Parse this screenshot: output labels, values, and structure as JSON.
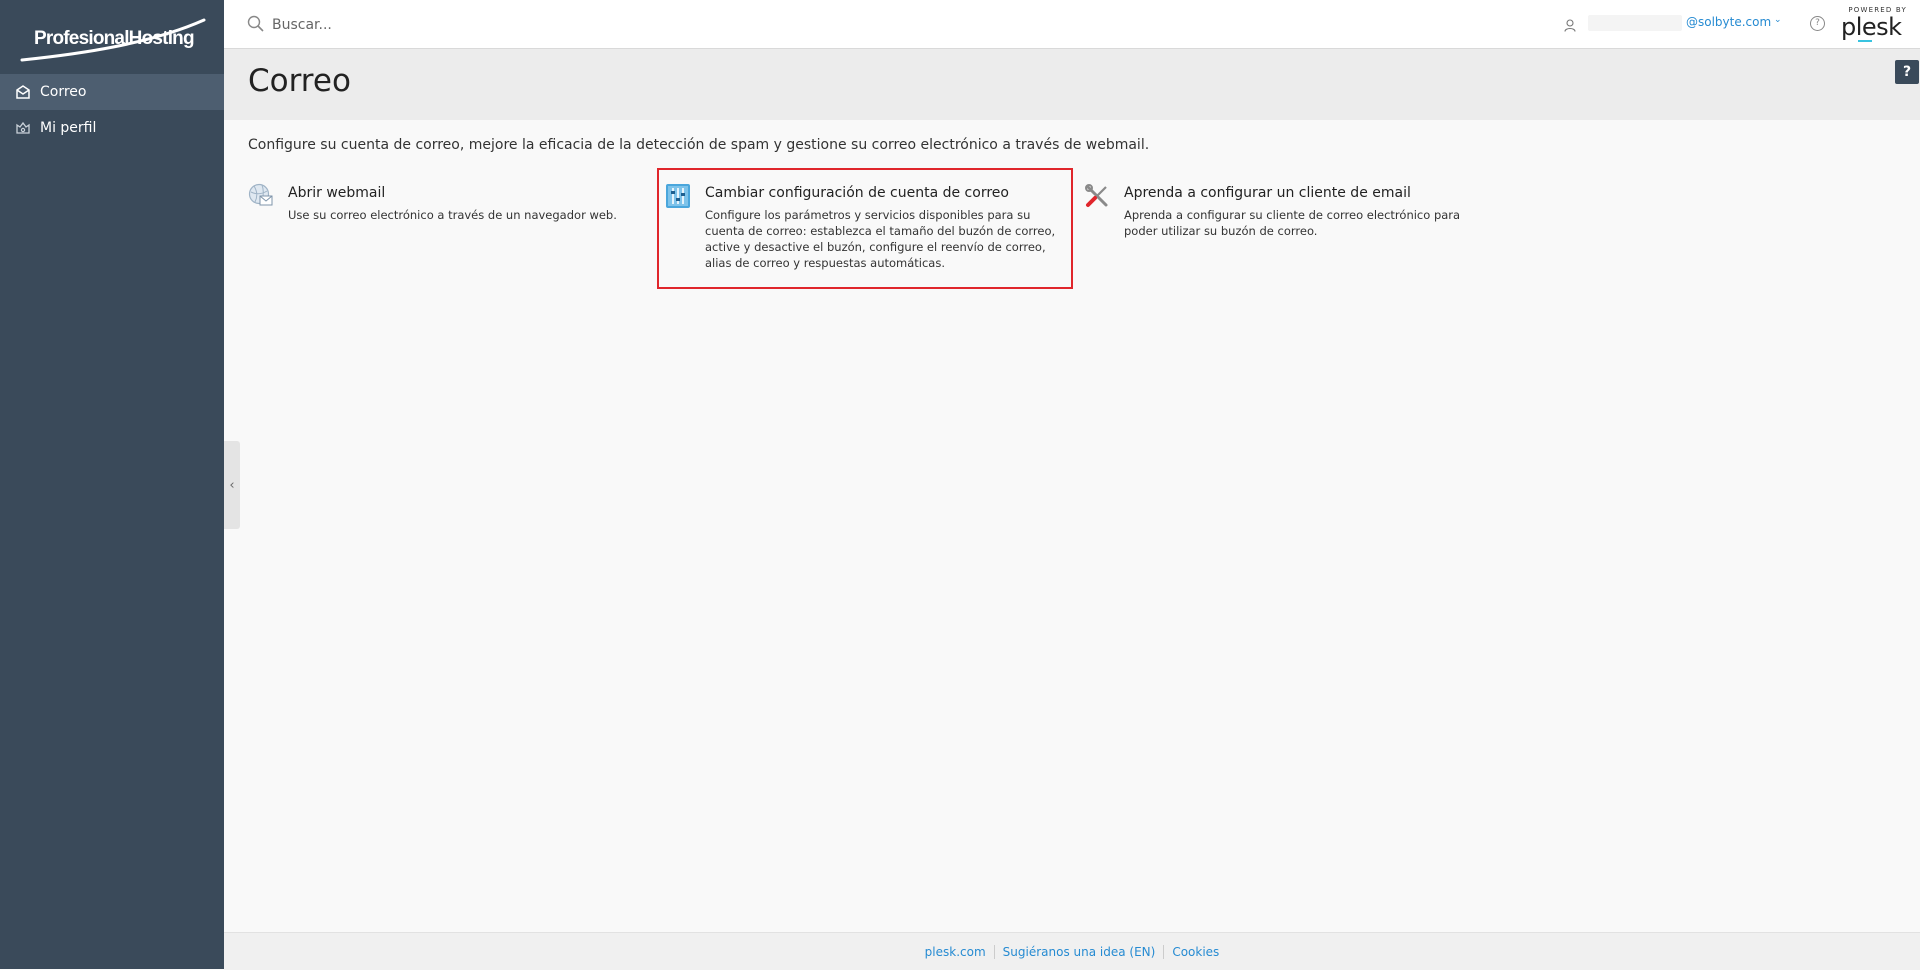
{
  "brand": {
    "logo_text": "ProfesionalHosting"
  },
  "sidebar": {
    "items": [
      {
        "label": "Correo",
        "icon": "envelope-icon",
        "active": true
      },
      {
        "label": "Mi perfil",
        "icon": "profile-icon",
        "active": false
      }
    ]
  },
  "topbar": {
    "search_placeholder": "Buscar...",
    "user_email": "@solbyte.com",
    "help_glyph": "?",
    "powered_by": "POWERED BY",
    "plesk_logo": "plesk"
  },
  "page": {
    "title": "Correo",
    "help_glyph": "?",
    "intro": "Configure su cuenta de correo, mejore la eficacia de la detección de spam y gestione su correo electrónico a través de webmail."
  },
  "tools": [
    {
      "title": "Abrir webmail",
      "description": "Use su correo electrónico a través de un navegador web.",
      "icon": "webmail-icon"
    },
    {
      "title": "Cambiar configuración de cuenta de correo",
      "description": "Configure los parámetros y servicios disponibles para su cuenta de correo: establezca el tamaño del buzón de correo, active y desactive el buzón, configure el reenvío de correo, alias de correo y respuestas automáticas.",
      "icon": "settings-sliders-icon",
      "selected": true
    },
    {
      "title": "Aprenda a configurar un cliente de email",
      "description": "Aprenda a configurar su cliente de correo electrónico para poder utilizar su buzón de correo.",
      "icon": "tools-icon"
    }
  ],
  "footer": {
    "links": [
      "plesk.com",
      "Sugiéranos una idea (EN)",
      "Cookies"
    ]
  },
  "colors": {
    "sidebar_bg": "#3a4a5a",
    "sidebar_active": "#4d5e70",
    "link": "#268bd2",
    "selection_border": "#e0262c"
  }
}
